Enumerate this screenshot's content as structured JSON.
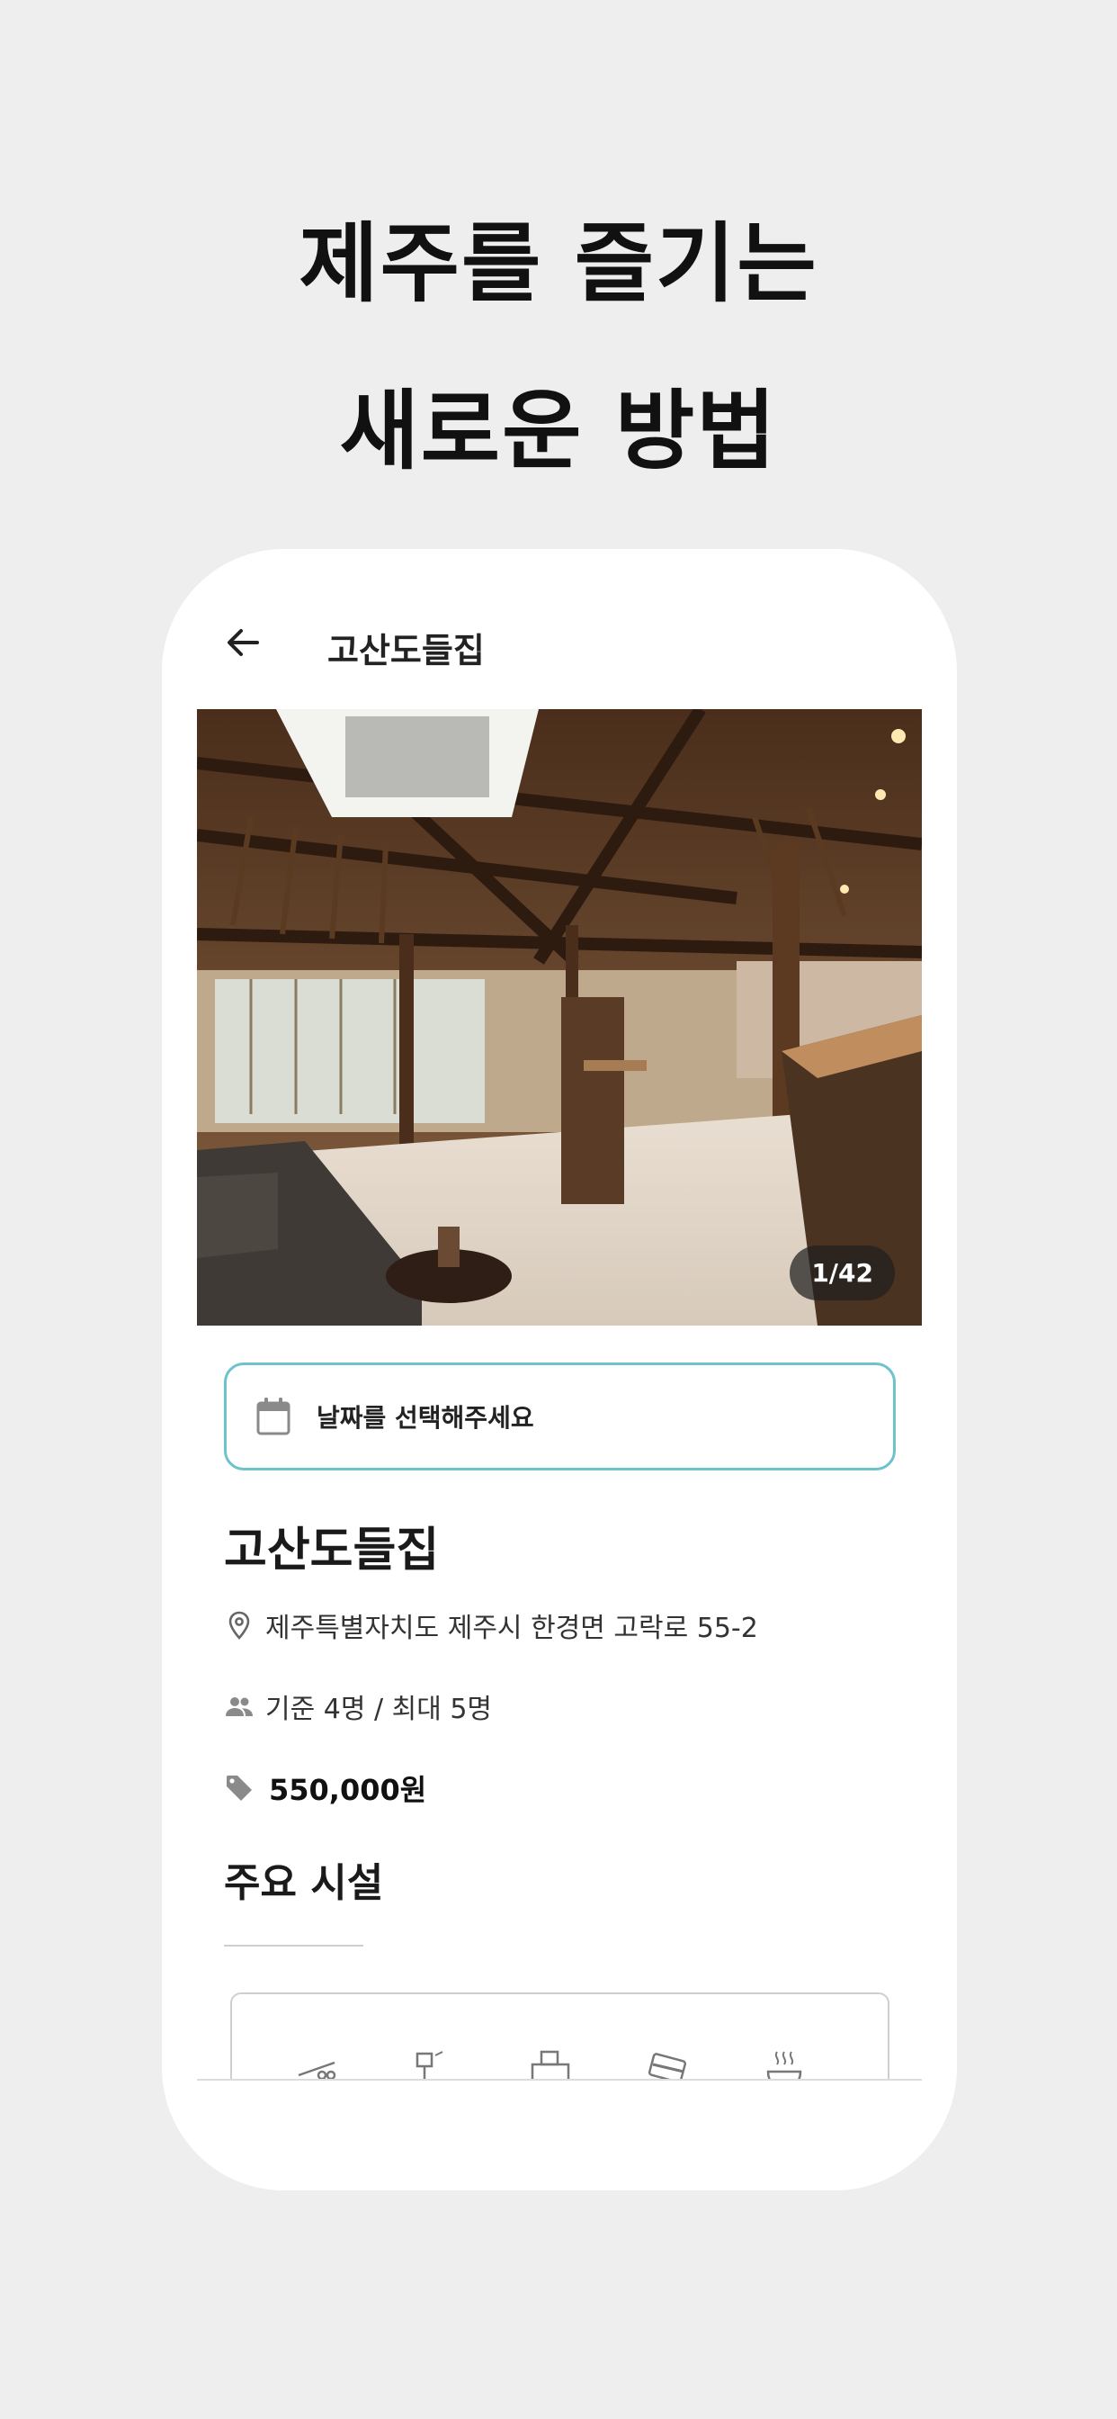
{
  "headline": {
    "line1": "제주를 즐기는",
    "line2": "새로운 방법"
  },
  "appbar": {
    "back_icon": "arrow-left-icon",
    "title": "고산도들집"
  },
  "photo": {
    "counter": "1/42",
    "current": 1,
    "total": 42
  },
  "date_picker": {
    "icon": "calendar-icon",
    "label": "날짜를 선택해주세요",
    "border_color": "#6cc3cc"
  },
  "place": {
    "name": "고산도들집",
    "address": "제주특별자치도 제주시 한경면 고락로 55-2",
    "capacity": "기준 4명 / 최대 5명",
    "price": "550,000원"
  },
  "facilities": {
    "title": "주요 시설",
    "icons": [
      "bbq-grill-icon",
      "shower-icon",
      "kitchen-appliance-icon",
      "card-icon",
      "hot-drink-icon"
    ]
  },
  "colors": {
    "background": "#eeeeee",
    "accent": "#6cc3cc",
    "text": "#1a1a1a"
  }
}
